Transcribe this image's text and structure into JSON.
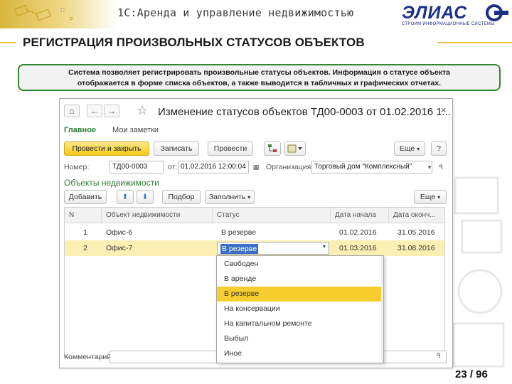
{
  "slide": {
    "app_title": "1С:Аренда и управление недвижимостью",
    "logo_text": "ЭЛИАС",
    "logo_sub": "СТРОИМ ИНФОРМАЦИОННЫЕ СИСТЕМЫ",
    "heading": "РЕГИСТРАЦИЯ ПРОИЗВОЛЬНЫХ СТАТУСОВ ОБЪЕКТОВ",
    "info_line1": "Система позволяет регистрировать произвольные статусы объектов. Информация о статусе объекта",
    "info_line2": "отображается в форме списка объектов, а также выводится в табличных и графических отчетах.",
    "page_number": "23 / 96",
    "accent_yellow": "#f0c24a",
    "accent_green": "#2f8a2f"
  },
  "window": {
    "title": "Изменение статусов объектов ТД00-0003 от 01.02.2016 1...",
    "close_icon": "close-icon",
    "tabs": {
      "main": "Главное",
      "notes": "Мои заметки"
    },
    "toolbar": {
      "post_close": "Провести и закрыть",
      "save": "Записать",
      "post": "Провести",
      "more": "Еще",
      "help": "?"
    },
    "fields": {
      "number_label": "Номер:",
      "number_value": "ТД00-0003",
      "date_label": "от:",
      "date_value": "01.02.2016 12:00:04",
      "org_label": "Организация:",
      "org_value": "Торговый дом \"Комплексный\""
    },
    "section_title": "Объекты недвижимости",
    "section_toolbar": {
      "add": "Добавить",
      "pick": "Подбор",
      "fill": "Заполнить",
      "more": "Еще"
    },
    "table": {
      "headers": [
        "N",
        "Объект недвижимости",
        "Статус",
        "Дата начала",
        "Дата оконч..."
      ],
      "rows": [
        {
          "n": "1",
          "object": "Офис-6",
          "status": "В резерве",
          "start": "01.02.2016",
          "end": "31.05.2016"
        },
        {
          "n": "2",
          "object": "Офис-7",
          "status": "В резерве",
          "start": "01.03.2016",
          "end": "31.08.2016"
        }
      ]
    },
    "dropdown": {
      "options": [
        "Свободен",
        "В аренде",
        "В резерве",
        "На консервации",
        "На капитальном ремонте",
        "Выбыл",
        "Иное"
      ],
      "selected": "В резерве"
    },
    "comment_label": "Комментарий:"
  }
}
